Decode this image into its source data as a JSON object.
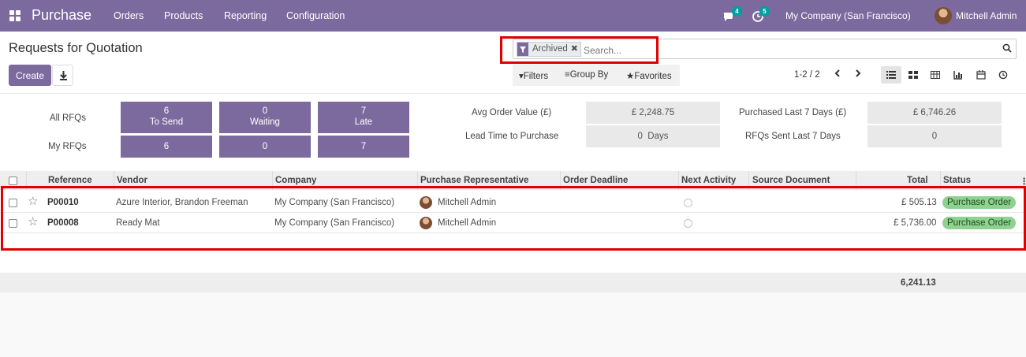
{
  "navbar": {
    "app_title": "Purchase",
    "menu": [
      "Orders",
      "Products",
      "Reporting",
      "Configuration"
    ],
    "messages_count": "4",
    "activities_count": "5",
    "company": "My Company (San Francisco)",
    "user": "Mitchell Admin"
  },
  "control_panel": {
    "breadcrumb": "Requests for Quotation",
    "create_label": "Create",
    "facet_label": "Archived",
    "search_placeholder": "Search...",
    "filters_label": "Filters",
    "groupby_label": "Group By",
    "favorites_label": "Favorites",
    "pager": "1-2 / 2"
  },
  "dashboard": {
    "all_rfqs_label": "All RFQs",
    "my_rfqs_label": "My RFQs",
    "all": {
      "to_send": "6",
      "to_send_label": "To Send",
      "waiting": "0",
      "waiting_label": "Waiting",
      "late": "7",
      "late_label": "Late"
    },
    "my": {
      "to_send": "6",
      "waiting": "0",
      "late": "7"
    },
    "avg_order_label": "Avg Order Value (£)",
    "avg_order_value": "£ 2,248.75",
    "lead_time_label": "Lead Time to Purchase",
    "lead_time_value": "0  Days",
    "purchased_label": "Purchased Last 7 Days (£)",
    "purchased_value": "£ 6,746.26",
    "rfqs_sent_label": "RFQs Sent Last 7 Days",
    "rfqs_sent_value": "0"
  },
  "table": {
    "headers": [
      "Reference",
      "Vendor",
      "Company",
      "Purchase Representative",
      "Order Deadline",
      "Next Activity",
      "Source Document",
      "Total",
      "Status"
    ],
    "rows": [
      {
        "reference": "P00010",
        "vendor": "Azure Interior, Brandon Freeman",
        "company": "My Company (San Francisco)",
        "rep": "Mitchell Admin",
        "total": "£ 505.13",
        "status": "Purchase Order"
      },
      {
        "reference": "P00008",
        "vendor": "Ready Mat",
        "company": "My Company (San Francisco)",
        "rep": "Mitchell Admin",
        "total": "£ 5,736.00",
        "status": "Purchase Order"
      }
    ],
    "sum_total": "6,241.13"
  },
  "colors": {
    "brand": "#7c6a9f",
    "status_green": "#8fd18f",
    "highlight": "#e00000"
  }
}
